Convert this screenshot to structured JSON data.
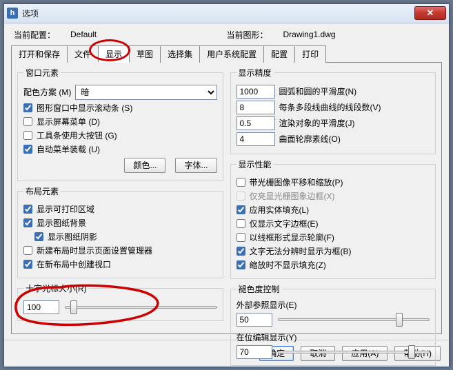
{
  "window": {
    "title": "选项",
    "close_x": "✕",
    "app_icon_letter": "h"
  },
  "config_row": {
    "current_cfg_label": "当前配置：",
    "current_cfg_value": "Default",
    "current_drawing_label": "当前图形：",
    "current_drawing_value": "Drawing1.dwg"
  },
  "tabs": [
    {
      "label": "打开和保存"
    },
    {
      "label": "文件"
    },
    {
      "label": "显示"
    },
    {
      "label": "草图"
    },
    {
      "label": "选择集"
    },
    {
      "label": "用户系统配置"
    },
    {
      "label": "配置"
    },
    {
      "label": "打印"
    }
  ],
  "left": {
    "window_elements": {
      "legend": "窗口元素",
      "color_scheme_label": "配色方案 (M)",
      "color_scheme_value": "暗",
      "cb_scrollbars": "图形窗口中显示滚动条 (S)",
      "cb_screen_menu": "显示屏幕菜单 (D)",
      "cb_large_buttons": "工具条使用大按钮 (G)",
      "cb_autoload_menu": "自动菜单装载 (U)",
      "btn_colors": "颜色...",
      "btn_fonts": "字体..."
    },
    "layout_elements": {
      "legend": "布局元素",
      "cb_show_printable": "显示可打印区域",
      "cb_show_paper_bg": "显示图纸背景",
      "cb_show_paper_shadow": "显示图纸阴影",
      "cb_new_layout_psm": "新建布局时显示页面设置管理器",
      "cb_create_vp": "在新布局中创建视口"
    },
    "crosshair": {
      "legend": "十字光标大小(R)",
      "value": "100"
    }
  },
  "right": {
    "display_accuracy": {
      "legend": "显示精度",
      "arc_smooth_label": "圆弧和圆的平滑度(N)",
      "arc_smooth_value": "1000",
      "polyline_segs_label": "每条多段线曲线的线段数(V)",
      "polyline_segs_value": "8",
      "render_smooth_label": "渲染对象的平滑度(J)",
      "render_smooth_value": "0.5",
      "surface_contours_label": "曲面轮廓素线(O)",
      "surface_contours_value": "4"
    },
    "display_perf": {
      "legend": "显示性能",
      "cb_pan_zoom_raster": "带光栅图像平移和缩放(P)",
      "cb_highlight_raster_frame": "仅亮显光栅图象边框(X)",
      "cb_apply_solid_fill": "应用实体填充(L)",
      "cb_text_frame_only": "仅显示文字边框(E)",
      "cb_wireframe_silhouette": "以线框形式显示轮廓(F)",
      "cb_text_res_frame": "文字无法分辨时显示为框(B)",
      "cb_no_fill_on_zoom": "缩放时不显示填充(Z)"
    },
    "fade": {
      "legend": "褪色度控制",
      "xref_label": "外部参照显示(E)",
      "xref_value": "50",
      "inplace_label": "在位编辑显示(Y)",
      "inplace_value": "70"
    }
  },
  "footer": {
    "ok": "确定",
    "cancel": "取消",
    "apply": "应用(A)",
    "help": "帮助(H)"
  }
}
